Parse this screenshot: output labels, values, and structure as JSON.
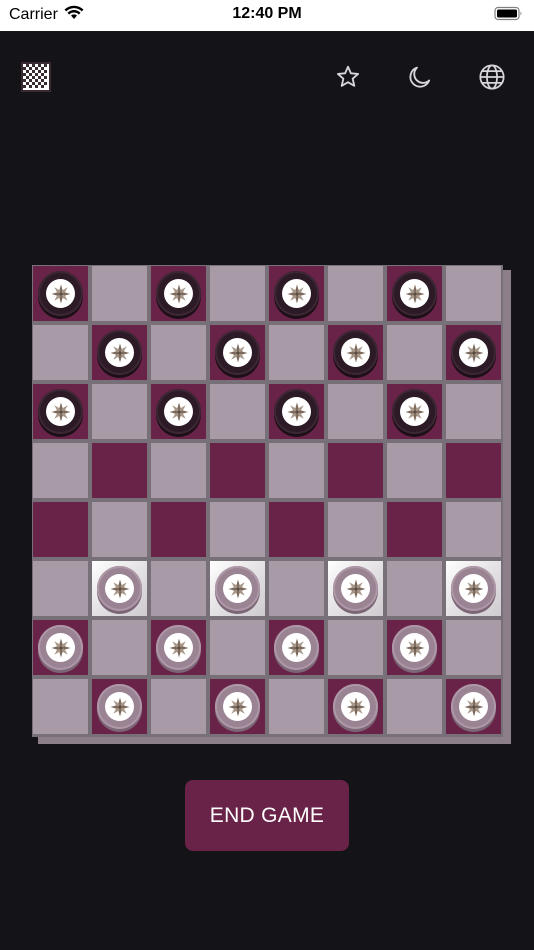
{
  "status_bar": {
    "carrier": "Carrier",
    "time": "12:40 PM",
    "icons": [
      "wifi-icon",
      "battery-icon"
    ]
  },
  "toolbar": {
    "left_icon": "checkerboard-logo-icon",
    "right_icons": [
      "star-icon",
      "moon-icon",
      "globe-icon"
    ]
  },
  "board": {
    "size": 8,
    "light_square_color": "#a89aa6",
    "dark_square_color": "#6a2348",
    "highlight_square_color": "#ffffff",
    "dark_piece_color": "#2c1a26",
    "light_piece_color": "#9a8393",
    "rows": [
      "D.D.D.D.",
      ".D.D.D.D",
      "D.D.D.D.",
      "........",
      "........",
      ".L.L.L.L",
      "L.L.L.L.",
      ".L.L.L.L"
    ],
    "highlighted": [
      [
        5,
        1
      ],
      [
        5,
        3
      ],
      [
        5,
        5
      ],
      [
        5,
        7
      ]
    ]
  },
  "actions": {
    "end_game_label": "END GAME"
  },
  "colors": {
    "background": "#141418",
    "accent": "#6a2348"
  }
}
